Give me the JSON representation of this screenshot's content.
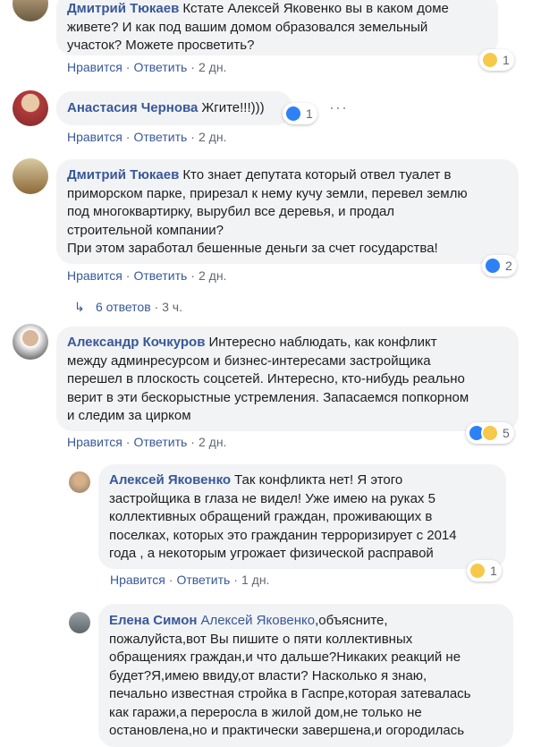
{
  "comments": [
    {
      "author": "Дмитрий Тюкаев",
      "lines": [
        "Кстате Алексей Яковенко вы в каком доме",
        "живете? И как под вашим домом образовался земельный",
        "участок? Можете просветить?"
      ],
      "like": "Нравится",
      "reply": "Ответить",
      "time": "2 дн.",
      "reaction_count": "1",
      "reaction": "wow-icon"
    },
    {
      "author": "Анастасия Чернова",
      "text": "Жгите!!!)))",
      "like": "Нравится",
      "reply": "Ответить",
      "time": "2 дн.",
      "reaction_count": "1",
      "reaction": "like-icon",
      "more": "···"
    },
    {
      "author": "Дмитрий Тюкаев",
      "lines": [
        "Кто знает депутата который отвел туалет в",
        "приморском парке, прирезал к нему кучу земли, перевел землю",
        "под многоквартирку, вырубил все деревья, и продал",
        "строительной компании?",
        "При этом заработал бешенные деньги за счет государства!"
      ],
      "like": "Нравится",
      "reply": "Ответить",
      "time": "2 дн.",
      "reaction_count": "2",
      "reaction": "like-icon",
      "replies": "6 ответов",
      "replies_time": "3 ч."
    },
    {
      "author": "Александр Кочкуров",
      "lines": [
        "Интересно наблюдать, как конфликт",
        "между админресурсом и бизнес-интересами застройщика",
        "перешел в плоскость соцсетей. Интересно, кто-нибудь реально",
        "верит в эти бескорыстные устремления. Запасаемся попкорном",
        "и следим за цирком"
      ],
      "like": "Нравится",
      "reply": "Ответить",
      "time": "2 дн.",
      "reaction_count": "5",
      "reaction": "like-haha-icons"
    },
    {
      "author": "Алексей Яковенко",
      "lines": [
        "Так конфликта нет! Я этого",
        "застройщика в глаза не видел! Уже имею на руках 5",
        "коллективных обращений граждан, проживающих в",
        "поселках, которых это гражданин терроризирует с 2014",
        "года , а некоторым угрожает физической расправой"
      ],
      "like": "Нравится",
      "reply": "Ответить",
      "time": "1 дн.",
      "reaction_count": "1",
      "reaction": "wow-icon"
    },
    {
      "author": "Елена Симон",
      "mention": "Алексей Яковенко",
      "lines": [
        ",объясните,",
        "пожалуйста,вот Вы пишите о пяти коллективных",
        "обращениях граждан,и что дальше?Никаких реакций не",
        "будет?Я,имею ввиду,от власти? Насколько я знаю,",
        "печально известная стройка в Гаспре,которая затевалась",
        "как гаражи,а переросла в жилой дом,не только не",
        "остановлена,но и практически завершена,и огородилась"
      ]
    }
  ],
  "colors": {
    "link": "#385898",
    "bubble": "#f2f3f5",
    "meta": "#606770",
    "like": "#2e81f4",
    "wow": "#f7c94a"
  }
}
